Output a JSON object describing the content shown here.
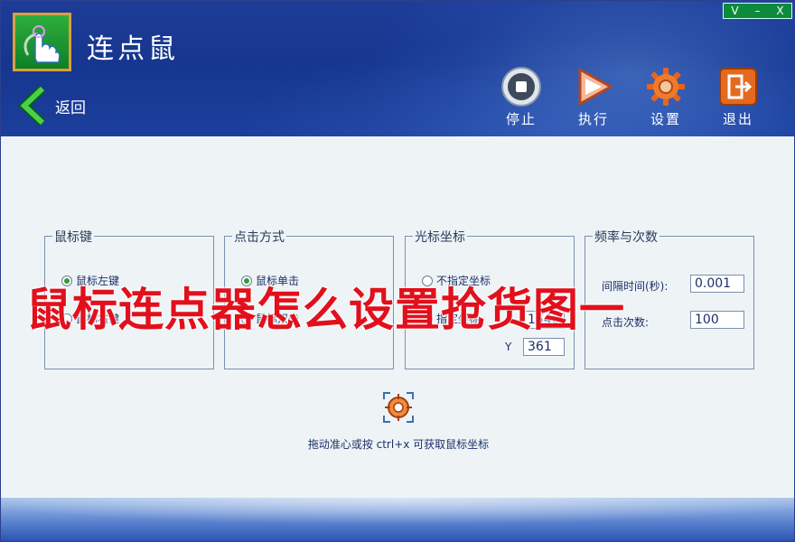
{
  "app": {
    "title": "连点鼠",
    "back_label": "返回"
  },
  "window_controls": [
    "V",
    "–",
    "X"
  ],
  "toolbar": [
    {
      "label": "停止",
      "icon": "stop-icon"
    },
    {
      "label": "执行",
      "icon": "play-icon"
    },
    {
      "label": "设置",
      "icon": "gear-icon"
    },
    {
      "label": "退出",
      "icon": "exit-icon"
    }
  ],
  "groups": {
    "mouse_key": {
      "title": "鼠标键",
      "options": [
        {
          "label": "鼠标左键",
          "checked": true
        },
        {
          "label": "鼠标右键",
          "checked": false
        }
      ]
    },
    "click_mode": {
      "title": "点击方式",
      "options": [
        {
          "label": "鼠标单击",
          "checked": true
        },
        {
          "label": "鼠标双击",
          "checked": false
        }
      ]
    },
    "cursor_coord": {
      "title": "光标坐标",
      "options": [
        {
          "label": "不指定坐标",
          "checked": false
        },
        {
          "label": "指定坐标",
          "checked": true
        }
      ],
      "x_value": "1540",
      "y_label": "Y",
      "y_value": "361"
    },
    "frequency": {
      "title": "频率与次数",
      "interval_label": "间隔时间(秒):",
      "interval_value": "0.001",
      "count_label": "点击次数:",
      "count_value": "100"
    }
  },
  "hint": "拖动准心或按 ctrl+x 可获取鼠标坐标",
  "overlay_text": "鼠标连点器怎么设置抢货图一",
  "colors": {
    "header": "#1b3f9c",
    "content_bg": "#eef4f6",
    "overlay_red": "#e1101c",
    "radio_checked": "#2f9c3a"
  }
}
